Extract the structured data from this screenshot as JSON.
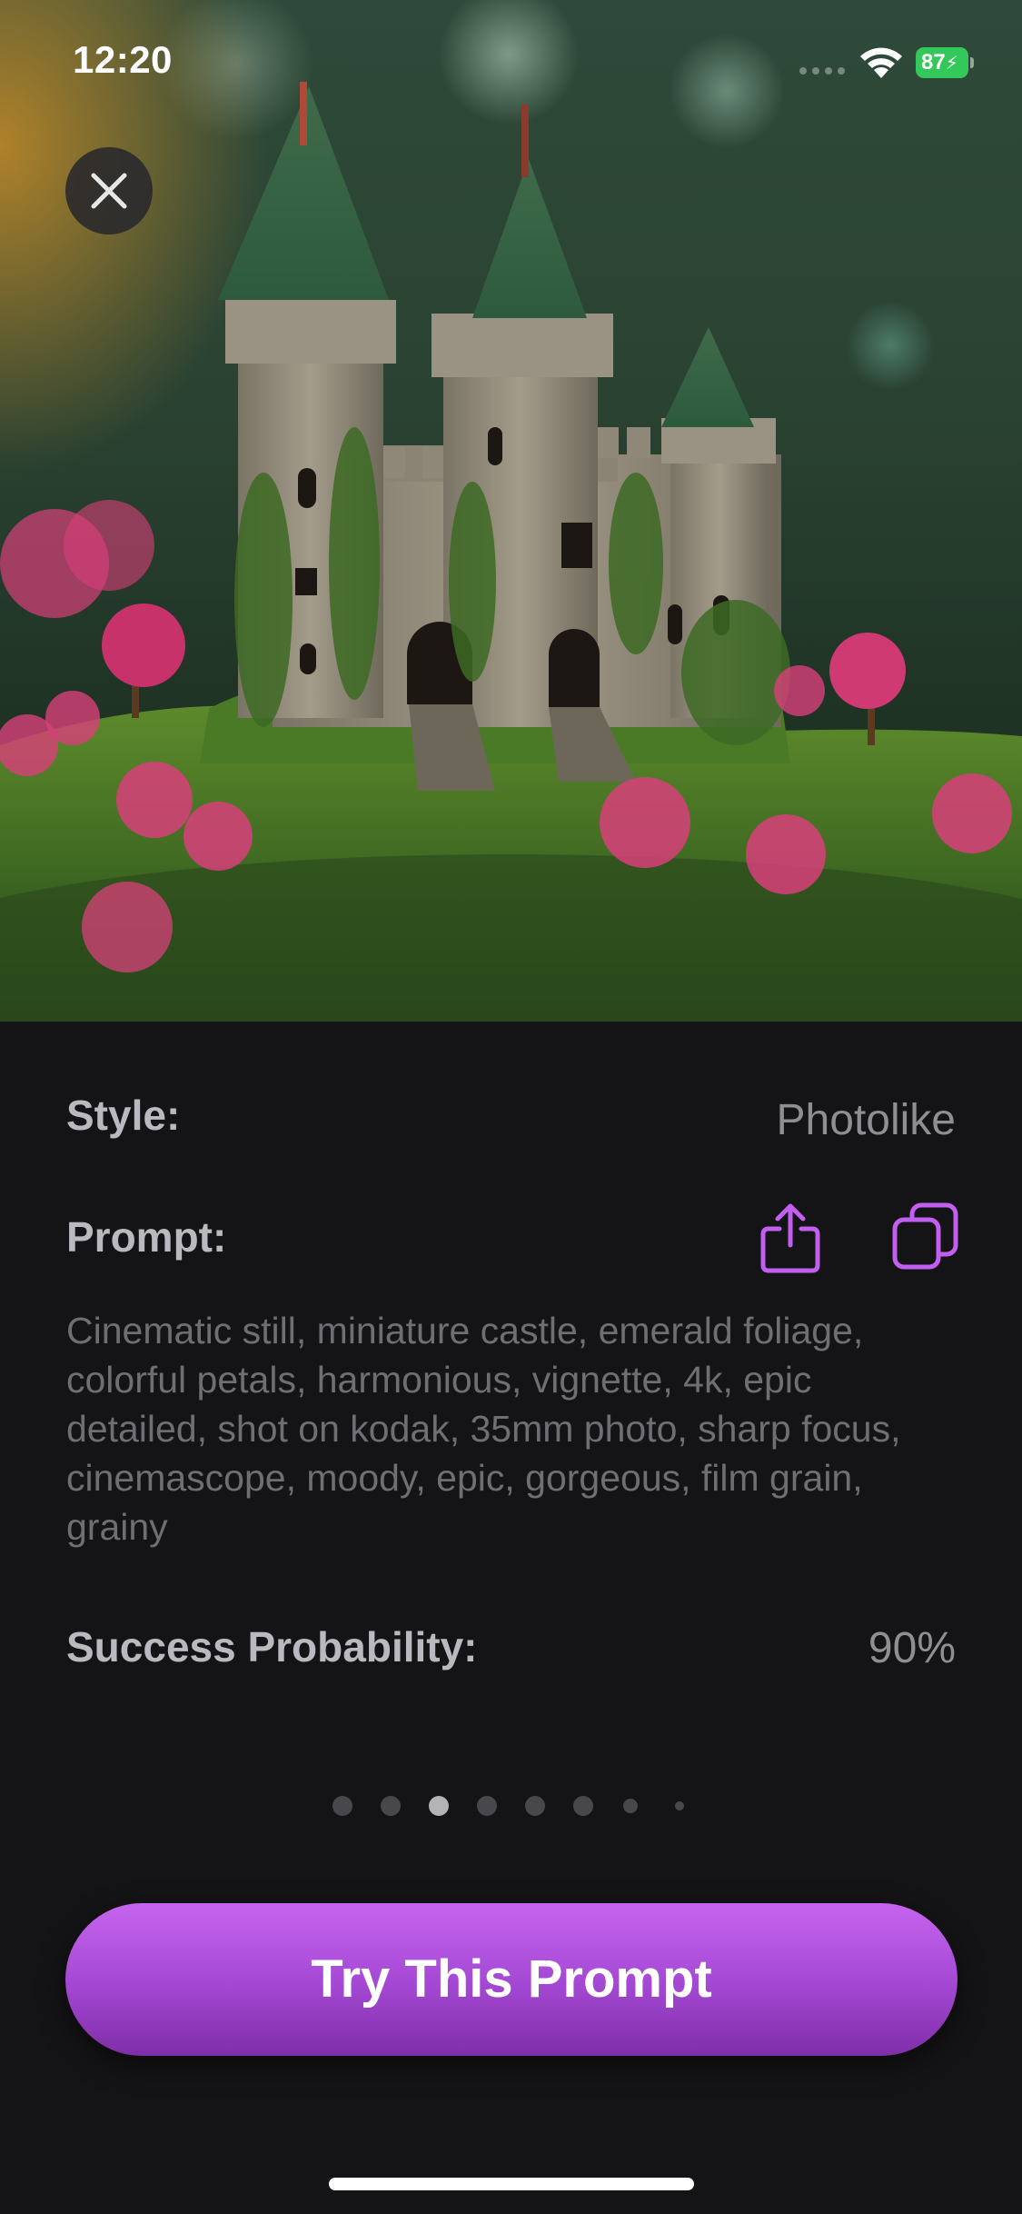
{
  "status_bar": {
    "time": "12:20",
    "battery": "87"
  },
  "hero": {
    "icon": "castle-photo"
  },
  "details": {
    "style_label": "Style:",
    "style_value": "Photolike",
    "prompt_label": "Prompt:",
    "prompt_text": "Cinematic still, miniature castle, emerald foliage, colorful petals, harmonious, vignette, 4k, epic detailed, shot on kodak, 35mm photo, sharp focus, cinemascope, moody, epic, gorgeous, film grain, grainy",
    "success_label": "Success Probability:",
    "success_value": "90%"
  },
  "pagination": {
    "total": 8,
    "current": 3
  },
  "cta": {
    "label": "Try This Prompt"
  },
  "colors": {
    "accent": "#b352e0",
    "background": "#141416",
    "battery": "#34c759"
  }
}
